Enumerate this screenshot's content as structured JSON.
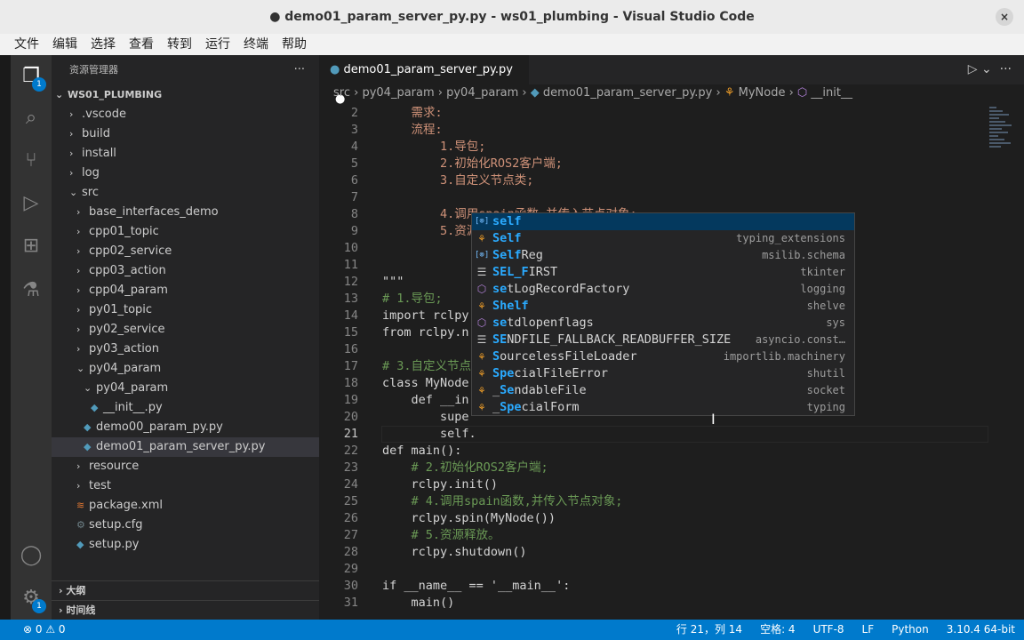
{
  "window": {
    "title": "● demo01_param_server_py.py - ws01_plumbing - Visual Studio Code",
    "close": "×"
  },
  "menu": [
    "文件",
    "编辑",
    "选择",
    "查看",
    "转到",
    "运行",
    "终端",
    "帮助"
  ],
  "activity": {
    "explorer_badge": "1",
    "settings_badge": "1"
  },
  "sidebar": {
    "title": "资源管理器",
    "more": "···",
    "root": "WS01_PLUMBING",
    "items": [
      ".vscode",
      "build",
      "install",
      "log",
      "src",
      "base_interfaces_demo",
      "cpp01_topic",
      "cpp02_service",
      "cpp03_action",
      "cpp04_param",
      "py01_topic",
      "py02_service",
      "py03_action",
      "py04_param",
      "py04_param",
      "__init__.py",
      "demo00_param_py.py",
      "demo01_param_server_py.py",
      "resource",
      "test",
      "package.xml",
      "setup.cfg",
      "setup.py"
    ],
    "outline": "大纲",
    "timeline": "时间线"
  },
  "tab": {
    "label": "demo01_param_server_py.py",
    "dirty": "●"
  },
  "breadcrumb": [
    "src",
    "py04_param",
    "py04_param",
    "demo01_param_server_py.py",
    "MyNode",
    "__init__"
  ],
  "code": {
    "lines": [
      {
        "n": "2",
        "t": "    需求:"
      },
      {
        "n": "3",
        "t": "    流程:"
      },
      {
        "n": "4",
        "t": "        1.导包;"
      },
      {
        "n": "5",
        "t": "        2.初始化ROS2客户端;"
      },
      {
        "n": "6",
        "t": "        3.自定义节点类;"
      },
      {
        "n": "7",
        "t": ""
      },
      {
        "n": "8",
        "t": "        4.调用spain函数,并传入节点对象;"
      },
      {
        "n": "9",
        "t": "        5.资源"
      },
      {
        "n": "10",
        "t": ""
      },
      {
        "n": "11",
        "t": ""
      },
      {
        "n": "12",
        "t": "\"\"\""
      },
      {
        "n": "13",
        "t": "# 1.导包;"
      },
      {
        "n": "14",
        "t": "import rclpy"
      },
      {
        "n": "15",
        "t": "from rclpy.n"
      },
      {
        "n": "16",
        "t": ""
      },
      {
        "n": "17",
        "t": "# 3.自定义节点"
      },
      {
        "n": "18",
        "t": "class MyNode"
      },
      {
        "n": "19",
        "t": "    def __in"
      },
      {
        "n": "20",
        "t": "        supe"
      },
      {
        "n": "21",
        "t": "        self."
      },
      {
        "n": "22",
        "t": "def main():"
      },
      {
        "n": "23",
        "t": "    # 2.初始化ROS2客户端;"
      },
      {
        "n": "24",
        "t": "    rclpy.init()"
      },
      {
        "n": "25",
        "t": "    # 4.调用spain函数,并传入节点对象;"
      },
      {
        "n": "26",
        "t": "    rclpy.spin(MyNode())"
      },
      {
        "n": "27",
        "t": "    # 5.资源释放。"
      },
      {
        "n": "28",
        "t": "    rclpy.shutdown()"
      },
      {
        "n": "29",
        "t": ""
      },
      {
        "n": "30",
        "t": "if __name__ == '__main__':"
      },
      {
        "n": "31",
        "t": "    main()"
      }
    ]
  },
  "suggest": [
    {
      "pre": "",
      "hl": "self",
      "post": "",
      "det": "",
      "icon": "variable"
    },
    {
      "pre": "",
      "hl": "Self",
      "post": "",
      "det": "typing_extensions",
      "icon": "class"
    },
    {
      "pre": "",
      "hl": "Self",
      "post": "Reg",
      "det": "msilib.schema",
      "icon": "variable"
    },
    {
      "pre": "",
      "hl": "SEL_F",
      "post": "IRST",
      "det": "tkinter",
      "icon": "constant"
    },
    {
      "pre": "",
      "hl": "se",
      "post": "tLogRecordFactory",
      "det": "logging",
      "icon": "method"
    },
    {
      "pre": "",
      "hl": "Shelf",
      "post": "",
      "det": "shelve",
      "icon": "class"
    },
    {
      "pre": "",
      "hl": "se",
      "post": "tdlopenflags",
      "det": "sys",
      "icon": "method"
    },
    {
      "pre": "",
      "hl": "SE",
      "post": "NDFILE_FALLBACK_READBUFFER_SIZE",
      "det": "asyncio.const…",
      "icon": "constant"
    },
    {
      "pre": "",
      "hl": "S",
      "post": "ourcelessFileLoader",
      "det": "importlib.machinery",
      "icon": "class"
    },
    {
      "pre": "",
      "hl": "Spe",
      "post": "cialFileError",
      "det": "shutil",
      "icon": "class"
    },
    {
      "pre": "_",
      "hl": "Se",
      "post": "ndableFile",
      "det": "socket",
      "icon": "class"
    },
    {
      "pre": "_",
      "hl": "Spe",
      "post": "cialForm",
      "det": "typing",
      "icon": "class"
    }
  ],
  "status": {
    "problems": "⊗ 0 ⚠ 0",
    "position": "行 21，列 14",
    "spaces": "空格: 4",
    "encoding": "UTF-8",
    "eol": "LF",
    "language": "Python",
    "interpreter": "3.10.4 64-bit"
  }
}
